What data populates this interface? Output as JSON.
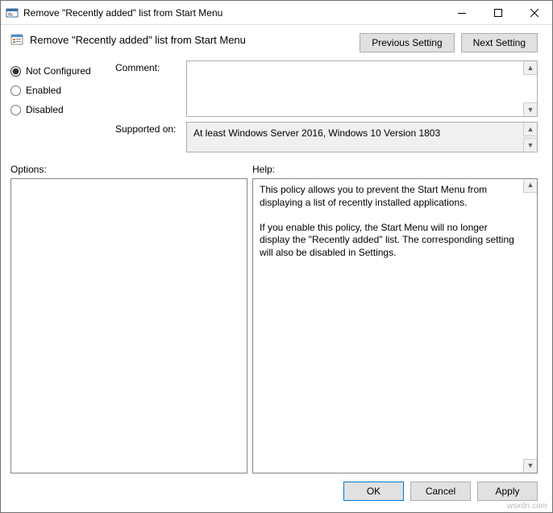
{
  "window": {
    "title": "Remove \"Recently added\" list from Start Menu"
  },
  "header": {
    "policy_name": "Remove \"Recently added\" list from Start Menu",
    "prev_btn": "Previous Setting",
    "next_btn": "Next Setting"
  },
  "states": {
    "not_configured": "Not Configured",
    "enabled": "Enabled",
    "disabled": "Disabled"
  },
  "fields": {
    "comment_label": "Comment:",
    "comment_value": "",
    "supported_label": "Supported on:",
    "supported_value": "At least Windows Server 2016, Windows 10 Version 1803"
  },
  "sections": {
    "options_label": "Options:",
    "help_label": "Help:"
  },
  "help": {
    "p1": "This policy allows you to prevent the Start Menu from displaying a list of recently installed applications.",
    "p2": "If you enable this policy, the Start Menu will no longer display the \"Recently added\" list.  The corresponding setting will also be disabled in Settings."
  },
  "footer": {
    "ok": "OK",
    "cancel": "Cancel",
    "apply": "Apply"
  },
  "watermark": "wsxdn.com"
}
